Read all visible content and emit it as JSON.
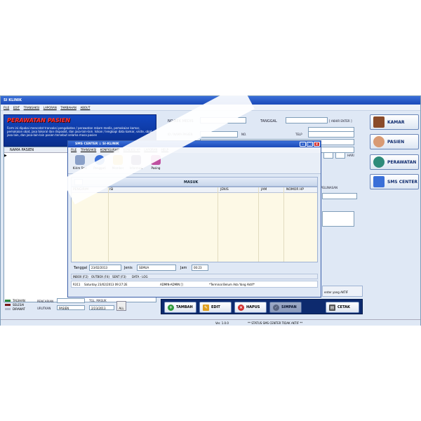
{
  "app": {
    "title": "SI KLINIK",
    "menu": [
      "FILE",
      "EDIT",
      "TRANSAKSI",
      "LAPORAN",
      "TAMBAHAN",
      "ABOUT"
    ]
  },
  "left": {
    "header_title": "PERAWATAN PASIEN",
    "header_desc": "Form ini dipakai mencatat transaksi pengobatan / perawatan rekam medis, pemakaian kamar, pemakaian obat, jasa tokoral dan dispoobt, dan jasa-lain-lain. Isikan / lengkapi data kamar, visite, obat, jasa lain, dan jasa-lain-lain pasien tersebut selama masa pasien",
    "grid_header": "NAMA PASIEN",
    "row_indicator": "▶"
  },
  "legend": [
    {
      "label": "TAGIHAN",
      "color": "#2e8b3a"
    },
    {
      "label": "SELESAI",
      "color": "#7a1a1a"
    },
    {
      "label": "DIRAWAT",
      "color": "#b0b8c8"
    }
  ],
  "search": {
    "pencarian_label": "PENCARIAN",
    "tgl_masuk_label": "TGL. MASUK",
    "urutkan_label": "URUTKAN",
    "urutkan_value": "PASIEN",
    "date_value": "2/23/2013",
    "all_label": "ALL"
  },
  "form": {
    "no_rek_label": "NO.REK MEDIS",
    "tanggal_label": "TANGGAL",
    "akhir_enter": "[ AKHIR ENTER ]",
    "id_nama_label": "ID / NAMA PASIEN",
    "no_label": "NO.",
    "telp_label": "TELP",
    "hari_label": "HARI",
    "pelunasan_label": "PELUNASAN",
    "center_aktif": "enter yang AKTIF"
  },
  "side_buttons": [
    {
      "label": "KAMAR",
      "color": "#8a4b2a"
    },
    {
      "label": "PASIEN",
      "color": "#d89a74"
    },
    {
      "label": "PERAWATAN",
      "color": "#2e8b7a"
    },
    {
      "label": "SMS CENTER",
      "color": "#3a6fd8"
    }
  ],
  "toolbar": {
    "tambah": "TAMBAH",
    "edit": "EDIT",
    "hapus": "HAPUS",
    "simpan": "SIMPAN",
    "cetak": "CETAK"
  },
  "status": {
    "version": "Ver. 1.0.0",
    "sms_status": "** STATUS SMS CENTER TIDAK AKTIF **"
  },
  "sms": {
    "title": "SMS CENTER :: SI-KLINIK",
    "menu": [
      "FILE",
      "TRANSAKSI",
      "KONFIGURASI",
      "KONEKSI HP",
      "LAPORAN",
      "HELP"
    ],
    "tools": [
      "Kirim Sms",
      "Penggati",
      "Member",
      "Informasi",
      "Pasing"
    ],
    "panel_title": "MASUK",
    "columns": [
      "PENGIRIM",
      "ISI",
      "JENIS",
      "JAM",
      "NOMOR HP"
    ],
    "filter": {
      "tanggal_label": "Tanggal",
      "tanggal_value": "23/02/2013",
      "jenis_label": "Jenis",
      "jenis_value": "SEMUA",
      "jam_label": "Jam",
      "jam_value": "00:23"
    },
    "tabs": [
      "INBOX (F2)",
      "OUTBOX (F4)",
      "SENT (F3)",
      "DATA - LOG"
    ],
    "statusbar": {
      "code": "R311",
      "datetime": "Saturday 23/02/2013 09:27:2E",
      "user": "ADMIN-ADMIN []",
      "terminal": "*Terminal Belum Ada Yang Aktif*"
    }
  }
}
